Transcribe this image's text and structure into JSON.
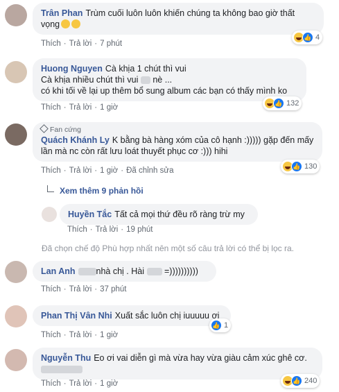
{
  "actions": {
    "like": "Thích",
    "reply": "Trả lời",
    "edit": "Đã chỉnh sửa"
  },
  "comments": [
    {
      "author": "Trân Phan",
      "text": "Trùm cuối luôn luôn khiến chúng ta không bao giờ thất vọng",
      "time": "7 phút",
      "reactions": "4"
    },
    {
      "author": "Huong Nguyen",
      "text1": "Cà khịa 1 chút thì vui",
      "text2a": "Cà khịa nhiều chút thì vui",
      "text2b": "nè ...",
      "text3": "có khi tối về lại up thêm bổ sung album các bạn có thấy mình ko",
      "time": "1 giờ",
      "reactions": "132"
    },
    {
      "badge": "Fan cứng",
      "author": "Quách Khánh Ly",
      "text": "K bằng bà hàng xóm của cô hạnh :))))) gặp đến mấy lần mà nc còn rất lưu loát thuyết phục cơ :))) hihi",
      "time": "1 giờ",
      "reactions": "130"
    },
    {
      "author": "Lan Anh",
      "text_a": "nhà chị . Hài",
      "text_b": "=))))))))))",
      "time": "37 phút"
    },
    {
      "author": "Phan Thị Vân Nhi",
      "text": "Xuất sắc luôn chị iuuuuu ơi",
      "time": "1 giờ",
      "reactions": "1"
    },
    {
      "author": "Nguyễn Thu",
      "text": "Eo ơi vai diễn gì mà vừa hay vừa giàu cảm xúc ghê cơ.",
      "time": "1 giờ",
      "reactions": "240"
    }
  ],
  "more_replies": "Xem thêm 9 phản hồi",
  "reply": {
    "author": "Huyền Tắc",
    "text": "Tất cả mọi thứ đều rõ ràng trừ my",
    "time": "19 phút"
  },
  "filter_note": "Đã chọn chế độ Phù hợp nhất nên một số câu trả lời có thể bị lọc ra."
}
